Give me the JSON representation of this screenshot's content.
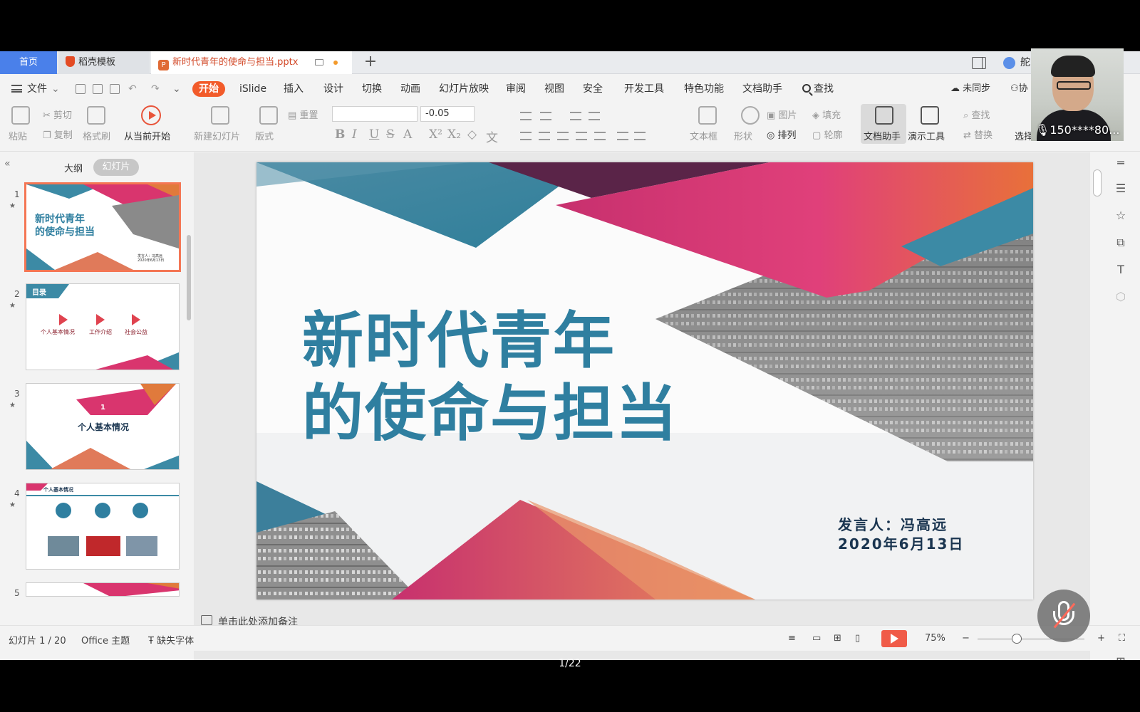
{
  "tabs": {
    "home": "首页",
    "template": "稻壳模板",
    "file": "新时代青年的使命与担当.pptx",
    "right_label": "舵"
  },
  "menu": {
    "file": "文件",
    "items": [
      "开始",
      "iSlide",
      "插入",
      "设计",
      "切换",
      "动画",
      "幻灯片放映",
      "审阅",
      "视图",
      "安全",
      "开发工具",
      "特色功能",
      "文档助手"
    ],
    "search": "查找",
    "sync": "未同步",
    "collab": "协"
  },
  "ribbon": {
    "paste": "粘贴",
    "cut": "剪切",
    "copy": "复制",
    "format_painter": "格式刷",
    "play_from_current": "从当前开始",
    "new_slide": "新建幻灯片",
    "layout": "版式",
    "reset": "重置",
    "font_size": "-0.05",
    "textbox": "文本框",
    "shape": "形状",
    "picture": "图片",
    "fill": "填充",
    "arrange": "排列",
    "outline": "轮廓",
    "doc_assistant": "文档助手",
    "presentation_tools": "演示工具",
    "find": "查找",
    "replace": "替换",
    "select": "选择"
  },
  "left_panel": {
    "outline_tab": "大纲",
    "slides_tab": "幻灯片",
    "thumbnails": [
      {
        "num": "1",
        "title": "新时代青年\n的使命与担当",
        "sub": "发言人：冯高远\n2020年6月13日"
      },
      {
        "num": "2",
        "label": "目录",
        "items": [
          "个人基本情况",
          "工作介绍",
          "社会公益"
        ]
      },
      {
        "num": "3",
        "number": "1",
        "title": "个人基本情况"
      },
      {
        "num": "4",
        "title": "个人基本情况"
      },
      {
        "num": "5"
      }
    ]
  },
  "slide": {
    "title_line1": "新时代青年",
    "title_line2": "的使命与担当",
    "speaker": "发言人：冯高远",
    "date": "2020年6月13日"
  },
  "notes_placeholder": "单击此处添加备注",
  "status": {
    "slide_count": "幻灯片 1 / 20",
    "theme": "Office 主题",
    "missing_font": "缺失字体",
    "zoom": "75%"
  },
  "overlay": {
    "caller": "150****80...",
    "page_indicator": "1/22"
  }
}
